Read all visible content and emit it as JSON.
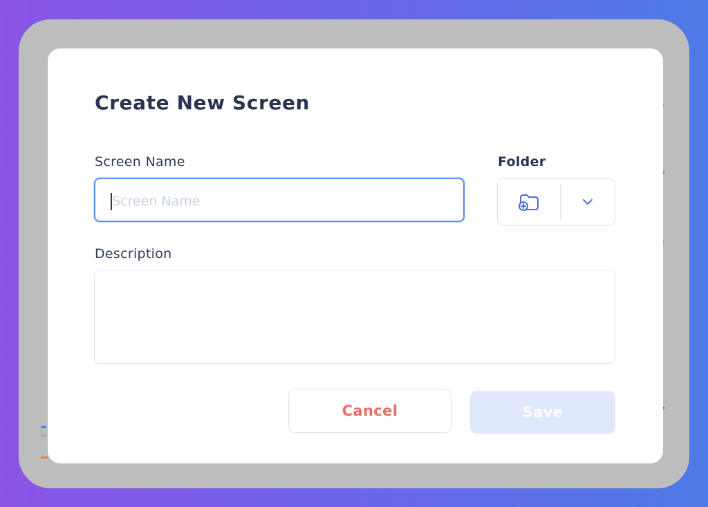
{
  "dialog": {
    "title": "Create New Screen",
    "screen_name_label": "Screen Name",
    "screen_name_value": "",
    "screen_name_placeholder": "Screen Name",
    "folder_label": "Folder",
    "folder_icon": "folder-add-icon",
    "chevron_icon": "chevron-down-icon",
    "description_label": "Description",
    "description_value": "",
    "cancel_label": "Cancel",
    "save_label": "Save"
  },
  "colors": {
    "title": "#2a3451",
    "input_focus_border": "#5b8ef0",
    "cancel_text": "#ec6c64",
    "save_bg_disabled": "#dfe8fc",
    "icon": "#4a6fd6"
  }
}
